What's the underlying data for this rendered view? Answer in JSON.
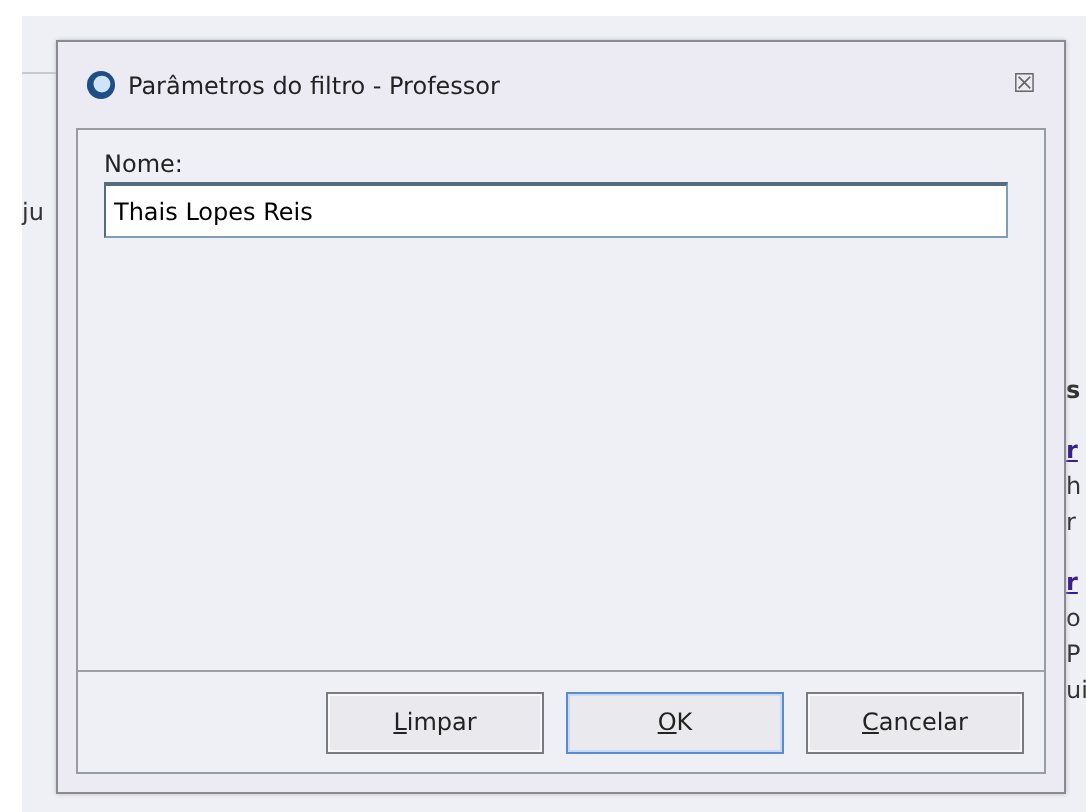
{
  "background": {
    "left_fragments": [
      {
        "text": "ju"
      }
    ],
    "right_fragments": [
      {
        "text": "s",
        "kind": "heading"
      },
      {
        "text": "r",
        "kind": "link"
      },
      {
        "text": "h",
        "kind": "plain"
      },
      {
        "text": "r",
        "kind": "plain"
      },
      {
        "text": "r",
        "kind": "link"
      },
      {
        "text": "o",
        "kind": "plain"
      },
      {
        "text": "P",
        "kind": "plain"
      },
      {
        "text": "ui",
        "kind": "plain"
      }
    ]
  },
  "dialog": {
    "title": "Parâmetros do filtro - Professor",
    "close": "☒",
    "field": {
      "label": "Nome:",
      "value": "Thais Lopes Reis"
    },
    "buttons": [
      {
        "label": "Limpar",
        "default": false
      },
      {
        "label": "OK",
        "default": true
      },
      {
        "label": "Cancelar",
        "default": false
      }
    ]
  }
}
